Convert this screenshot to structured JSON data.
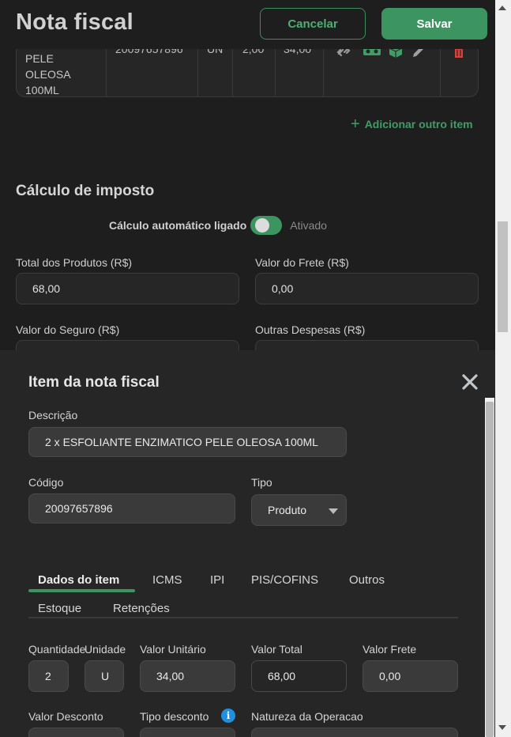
{
  "header": {
    "title": "Nota fiscal",
    "cancel_label": "Cancelar",
    "save_label": "Salvar"
  },
  "item_row": {
    "description_lines": [
      "PELE",
      "OLEOSA",
      "100ML"
    ],
    "code": "20097657896",
    "unit": "UN",
    "quantity": "2,00",
    "unit_value": "34,00",
    "action_icons": [
      "link-icon",
      "ticket-icon",
      "box-icon",
      "edit-icon",
      "trash-icon"
    ]
  },
  "add_item_label": "Adicionar outro item",
  "tax": {
    "section_title": "Cálculo de imposto",
    "auto_label": "Cálculo automático ligado",
    "auto_state": "Ativado",
    "auto_on": true,
    "fields": {
      "total_products_label": "Total dos Produtos (R$)",
      "total_products_value": "68,00",
      "freight_label": "Valor do Frete (R$)",
      "freight_value": "0,00",
      "insurance_label": "Valor do Seguro (R$)",
      "other_expenses_label": "Outras Despesas (R$)"
    }
  },
  "modal": {
    "title": "Item da nota fiscal",
    "description_label": "Descrição",
    "description_value": "2 x ESFOLIANTE ENZIMATICO PELE OLEOSA 100ML",
    "code_label": "Código",
    "code_value": "20097657896",
    "type_label": "Tipo",
    "type_value": "Produto",
    "tabs": [
      "Dados do item",
      "ICMS",
      "IPI",
      "PIS/COFINS",
      "Outros",
      "Estoque",
      "Retenções"
    ],
    "active_tab": "Dados do item",
    "grid": {
      "quantity_label": "Quantidade",
      "quantity_value": "2",
      "unit_label": "Unidade",
      "unit_value": "U",
      "unit_price_label": "Valor Unitário",
      "unit_price_value": "34,00",
      "total_label": "Valor Total",
      "total_value": "68,00",
      "freight_label": "Valor Frete",
      "freight_value": "0,00",
      "discount_label": "Valor Desconto",
      "discount_type_label": "Tipo desconto",
      "nature_label": "Natureza da Operacao"
    }
  },
  "colors": {
    "accent": "#3c9460",
    "background": "#1e1e1e",
    "modal_bg": "#262626",
    "danger": "#d9423a",
    "info": "#1f8fe0"
  }
}
